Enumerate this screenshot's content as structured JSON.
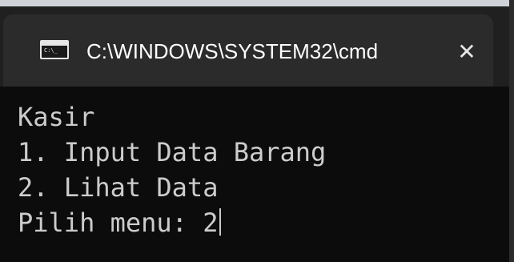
{
  "window": {
    "tab_title": "C:\\WINDOWS\\SYSTEM32\\cmd",
    "tab_icon": "terminal-icon",
    "close_symbol": "✕",
    "icon_prompt": "C:\\_"
  },
  "console": {
    "lines": [
      "Kasir",
      "1. Input Data Barang",
      "2. Lihat Data"
    ],
    "prompt_text": "Pilih menu: ",
    "input_value": "2"
  },
  "colors": {
    "background": "#0c0c0c",
    "text": "#cccccc",
    "tab": "#2b2b2b"
  }
}
